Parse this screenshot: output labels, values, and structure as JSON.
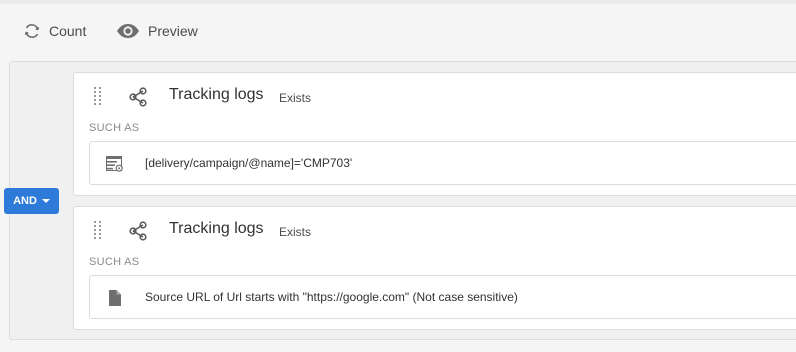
{
  "toolbar": {
    "count_label": "Count",
    "preview_label": "Preview"
  },
  "operator": {
    "label": "AND"
  },
  "rules": [
    {
      "title": "Tracking logs",
      "qualifier": "Exists",
      "section_label": "SUCH AS",
      "condition_icon": "expression-settings-icon",
      "condition": "[delivery/campaign/@name]='CMP703'"
    },
    {
      "title": "Tracking logs",
      "qualifier": "Exists",
      "section_label": "SUCH AS",
      "condition_icon": "document-icon",
      "condition": "Source URL of Url starts with \"https://google.com\" (Not case sensitive)"
    }
  ],
  "colors": {
    "accent": "#2d7ad9",
    "icon": "#6e6e6e",
    "background": "#f5f5f5"
  }
}
